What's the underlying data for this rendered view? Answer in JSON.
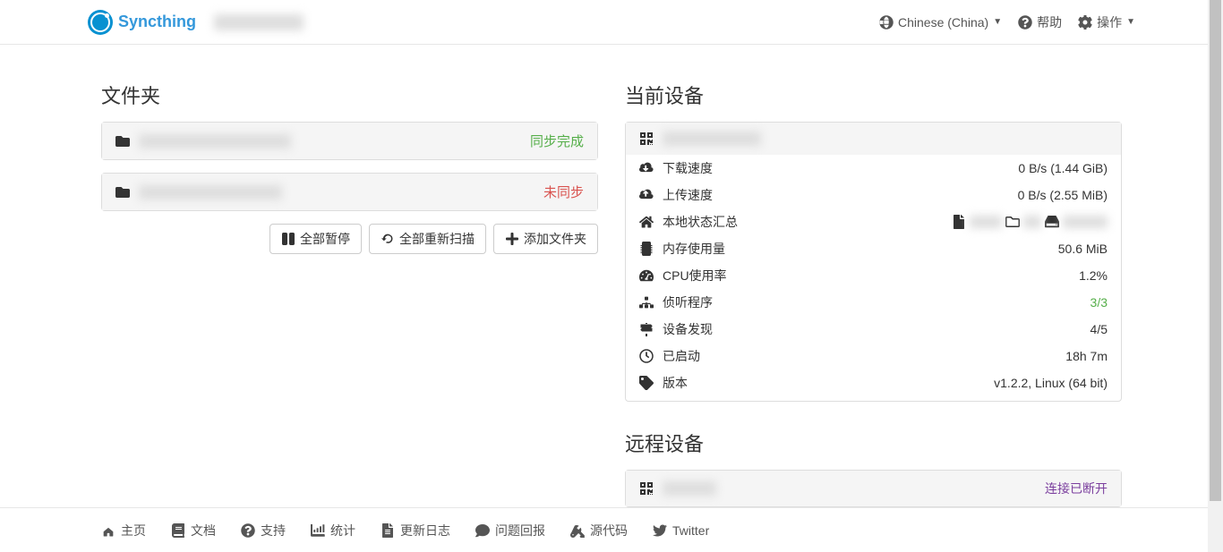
{
  "brand": "Syncthing",
  "nav": {
    "language": "Chinese (China)",
    "help": "帮助",
    "actions": "操作"
  },
  "sections": {
    "folders": "文件夹",
    "this_device": "当前设备",
    "remote_devices": "远程设备"
  },
  "folders": [
    {
      "name_blur": "████████████",
      "status": "同步完成",
      "status_class": "status-green"
    },
    {
      "name_blur": "██████████",
      "status": "未同步",
      "status_class": "status-red"
    }
  ],
  "folder_buttons": {
    "pause_all": "全部暂停",
    "rescan_all": "全部重新扫描",
    "add_folder": "添加文件夹"
  },
  "device_name_blur": "███████",
  "stats": {
    "download_speed": {
      "label": "下载速度",
      "value": "0 B/s (1.44 GiB)"
    },
    "upload_speed": {
      "label": "上传速度",
      "value": "0 B/s (2.55 MiB)"
    },
    "local_state": {
      "label": "本地状态汇总"
    },
    "ram": {
      "label": "内存使用量",
      "value": "50.6 MiB"
    },
    "cpu": {
      "label": "CPU使用率",
      "value": "1.2%"
    },
    "listeners": {
      "label": "侦听程序",
      "value": "3/3"
    },
    "discovery": {
      "label": "设备发现",
      "value": "4/5"
    },
    "uptime": {
      "label": "已启动",
      "value": "18h 7m"
    },
    "version": {
      "label": "版本",
      "value": "v1.2.2, Linux (64 bit)"
    }
  },
  "remote": {
    "name_blur": "████",
    "status": "连接已断开"
  },
  "footer": {
    "home": "主页",
    "docs": "文档",
    "support": "支持",
    "stats": "统计",
    "changelog": "更新日志",
    "bugs": "问题回报",
    "source": "源代码",
    "twitter": "Twitter"
  }
}
